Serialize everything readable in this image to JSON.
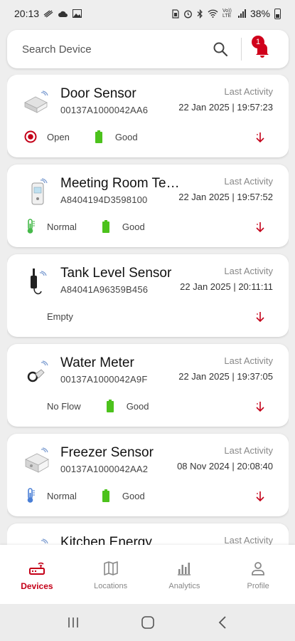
{
  "status_bar": {
    "time": "20:13",
    "net_label": "Vo)) LTE",
    "battery": "38%"
  },
  "search": {
    "placeholder": "Search Device",
    "notification_count": "1"
  },
  "devices": [
    {
      "name": "Door Sensor",
      "id": "00137A1000042AA6",
      "last_label": "Last Activity",
      "last_time": "22 Jan 2025 | 19:57:23",
      "status1": "Open",
      "status2": "Good",
      "icon": "door-sensor-icon",
      "status1_icon": "record-icon",
      "status2_icon": "battery-icon"
    },
    {
      "name": "Meeting Room Temp Sensor",
      "id": "A8404194D3598100",
      "last_label": "Last Activity",
      "last_time": "22 Jan 2025 | 19:57:52",
      "status1": "Normal",
      "status2": "Good",
      "icon": "temperature-sensor-icon",
      "status1_icon": "thermometer-icon",
      "status2_icon": "battery-icon"
    },
    {
      "name": "Tank Level Sensor",
      "id": "A84041A96359B456",
      "last_label": "Last Activity",
      "last_time": "22 Jan 2025 | 20:11:11",
      "status1": "Empty",
      "status2": "",
      "icon": "tank-level-sensor-icon",
      "status1_icon": "",
      "status2_icon": ""
    },
    {
      "name": "Water Meter",
      "id": "00137A1000042A9F",
      "last_label": "Last Activity",
      "last_time": "22 Jan 2025 | 19:37:05",
      "status1": "No Flow",
      "status2": "Good",
      "icon": "water-meter-icon",
      "status1_icon": "",
      "status2_icon": "battery-icon"
    },
    {
      "name": "Freezer Sensor",
      "id": "00137A1000042AA2",
      "last_label": "Last Activity",
      "last_time": "08 Nov 2024 | 20:08:40",
      "status1": "Normal",
      "status2": "Good",
      "icon": "freezer-sensor-icon",
      "status1_icon": "thermometer-icon",
      "status2_icon": "battery-icon"
    },
    {
      "name": "Kitchen Energy",
      "id": "",
      "last_label": "Last Activity",
      "last_time": "",
      "status1": "",
      "status2": "",
      "icon": "energy-sensor-icon",
      "status1_icon": "",
      "status2_icon": ""
    }
  ],
  "nav": {
    "devices": "Devices",
    "locations": "Locations",
    "analytics": "Analytics",
    "profile": "Profile"
  },
  "colors": {
    "accent": "#c40018",
    "battery": "#4cc21c",
    "thermo_green": "#46b94a",
    "thermo_blue": "#4a7fd6"
  }
}
